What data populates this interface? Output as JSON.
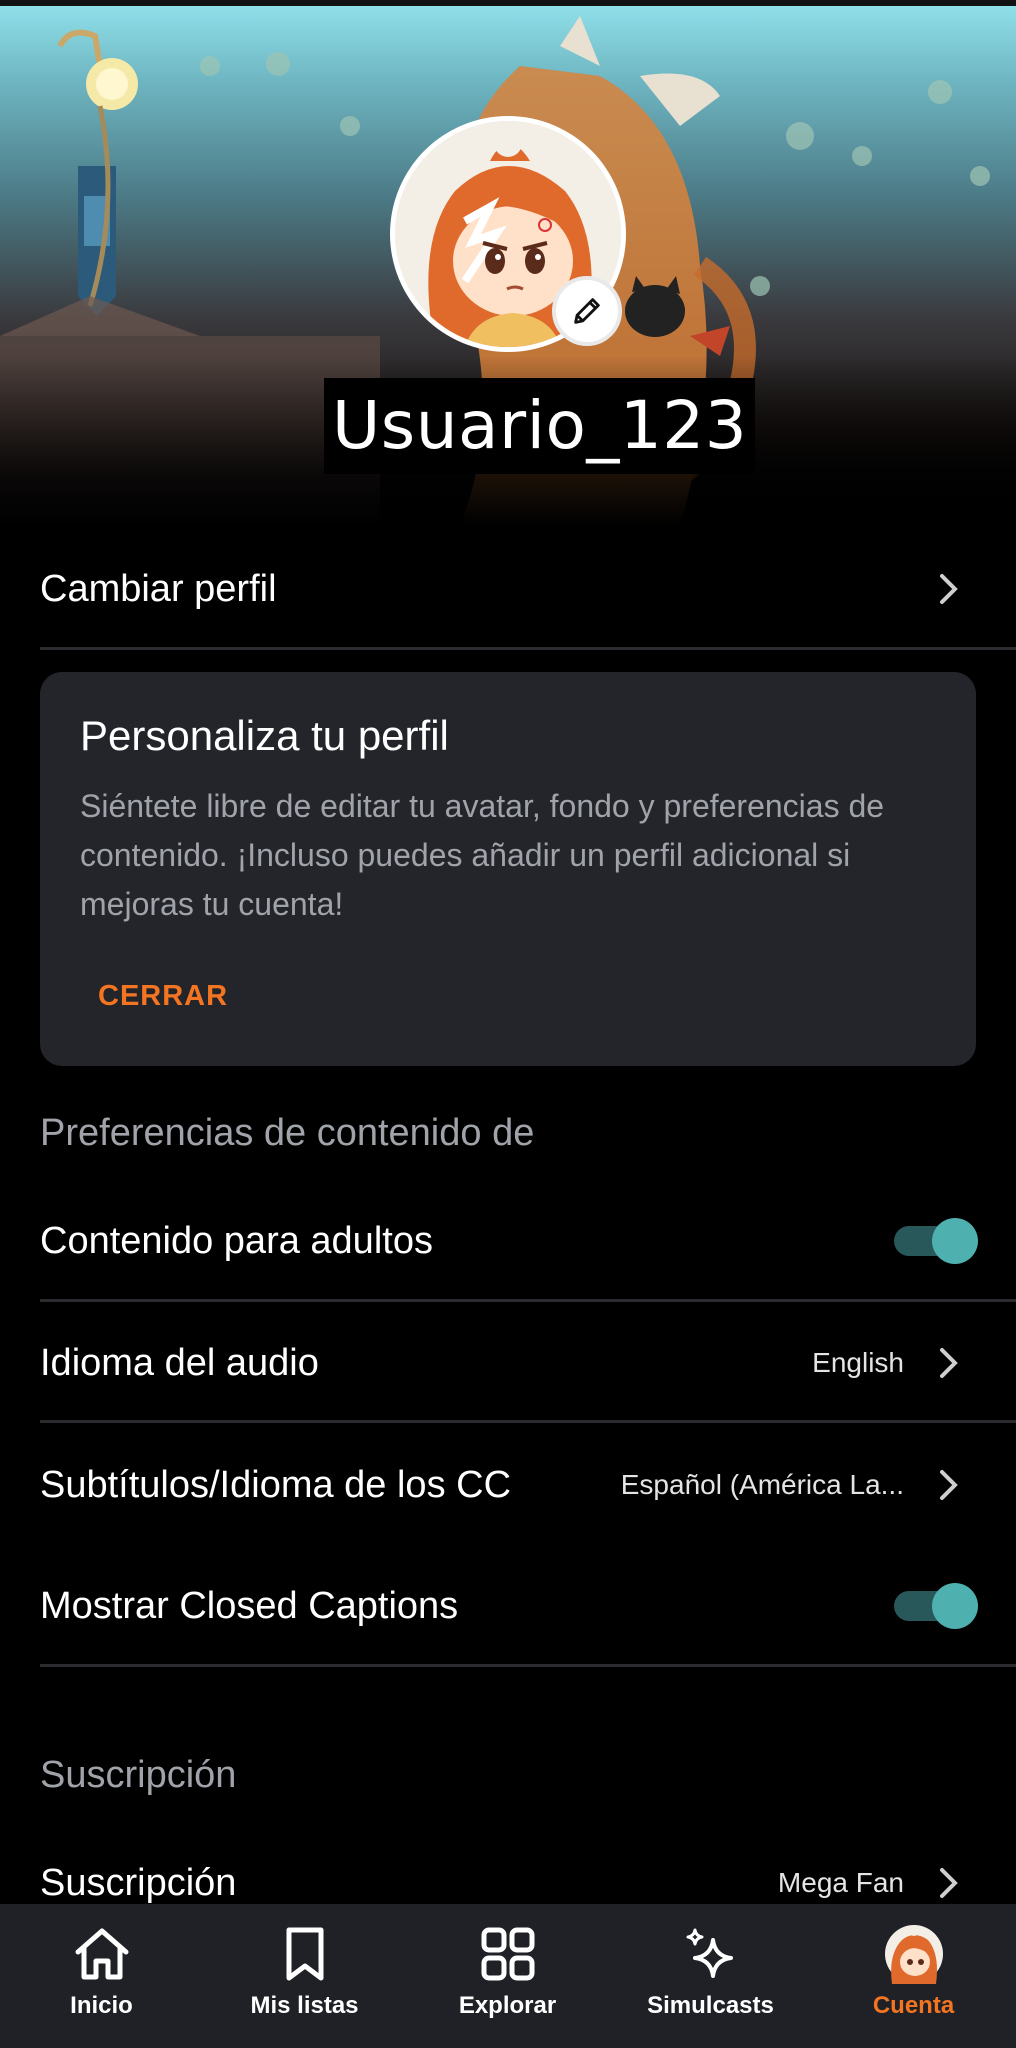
{
  "profile": {
    "username": "Usuario_123",
    "change_profile_label": "Cambiar perfil"
  },
  "customize_card": {
    "title": "Personaliza tu perfil",
    "body": "Siéntete libre de editar tu avatar, fondo y preferencias de contenido. ¡Incluso puedes añadir un perfil adicional si mejoras tu cuenta!",
    "close_label": "CERRAR"
  },
  "content_prefs": {
    "section_title": "Preferencias de contenido de",
    "adult_content": {
      "label": "Contenido para adultos",
      "enabled": true
    },
    "audio_language": {
      "label": "Idioma del audio",
      "value": "English"
    },
    "subtitles": {
      "label": "Subtítulos/Idioma de los CC",
      "value": "Español (América La..."
    },
    "closed_captions": {
      "label": "Mostrar Closed Captions",
      "enabled": true
    }
  },
  "subscription": {
    "section_title": "Suscripción",
    "label": "Suscripción",
    "value": "Mega Fan"
  },
  "tabbar": {
    "tabs": [
      {
        "label": "Inicio",
        "icon": "home-icon",
        "active": false
      },
      {
        "label": "Mis listas",
        "icon": "bookmark-icon",
        "active": false
      },
      {
        "label": "Explorar",
        "icon": "grid-icon",
        "active": false
      },
      {
        "label": "Simulcasts",
        "icon": "sparkle-icon",
        "active": false
      },
      {
        "label": "Cuenta",
        "icon": "avatar-icon",
        "active": true
      }
    ]
  },
  "colors": {
    "accent": "#f47521",
    "toggle_on": "#4fb0b0",
    "card_bg": "#23252b",
    "tabbar_bg": "#1f2126"
  }
}
